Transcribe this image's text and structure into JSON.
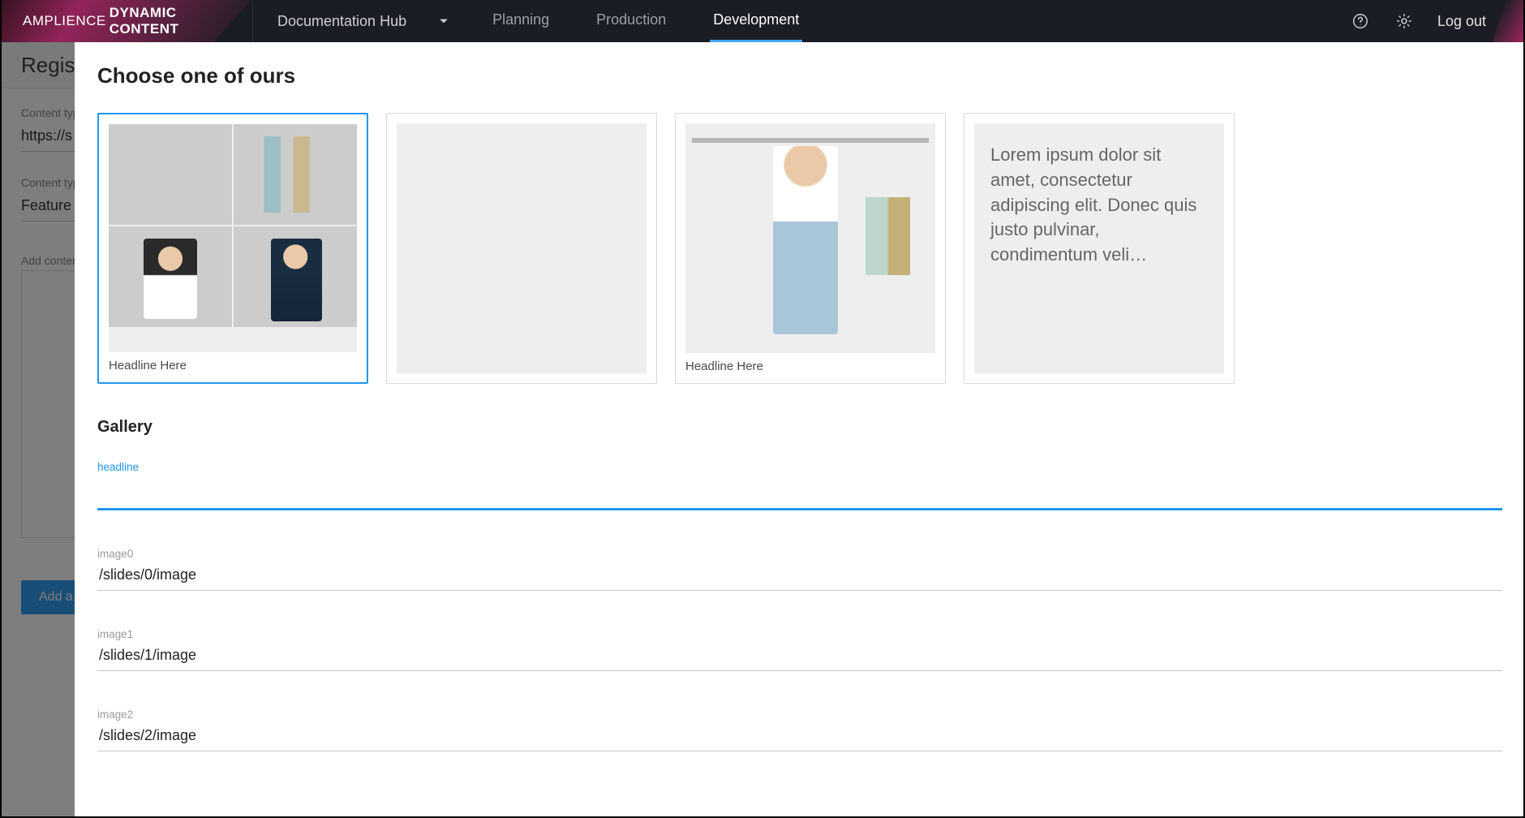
{
  "brand": {
    "light": "AMPLIENCE",
    "bold": "DYNAMIC CONTENT"
  },
  "hubSelector": "Documentation Hub",
  "navTabs": [
    "Planning",
    "Production",
    "Development"
  ],
  "activeTab": "Development",
  "logout": "Log out",
  "bg": {
    "header": "Register content type",
    "label1": "Content type schema",
    "value1": "https://s",
    "label2": "Content type label",
    "value2": "Feature ",
    "label3": "Add content type icon",
    "button": "Add a visualization"
  },
  "modal": {
    "title": "Choose one of ours",
    "cards": [
      {
        "caption": "Headline Here",
        "selected": true,
        "kind": "grid"
      },
      {
        "caption": "",
        "selected": false,
        "kind": "hair"
      },
      {
        "caption": "Headline Here",
        "selected": false,
        "kind": "shop"
      },
      {
        "caption": "",
        "selected": false,
        "kind": "text",
        "text": "Lorem ipsum dolor sit amet, consectetur adipiscing elit. Donec quis justo pulvinar, condimentum veli…"
      }
    ],
    "sectionTitle": "Gallery",
    "fields": [
      {
        "label": "headline",
        "value": "",
        "focused": true
      },
      {
        "label": "image0",
        "value": "/slides/0/image",
        "focused": false
      },
      {
        "label": "image1",
        "value": "/slides/1/image",
        "focused": false
      },
      {
        "label": "image2",
        "value": "/slides/2/image",
        "focused": false
      }
    ]
  }
}
